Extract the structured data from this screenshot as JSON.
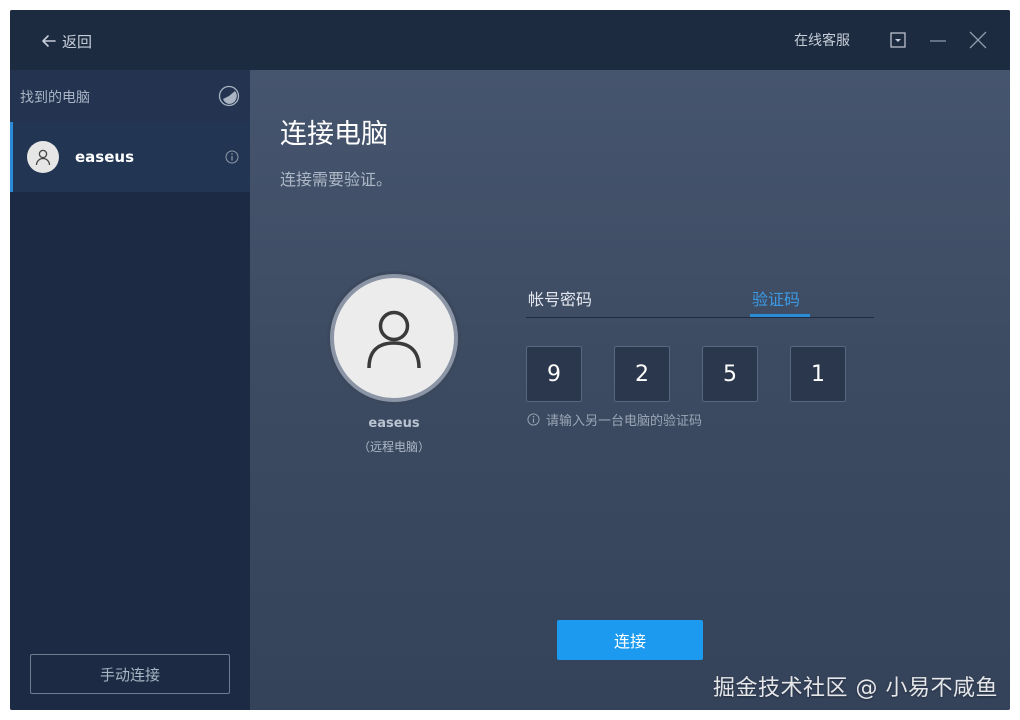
{
  "titlebar": {
    "back_label": "返回",
    "support_label": "在线客服",
    "icons": [
      "arrow-left-icon",
      "dropdown-icon",
      "minimize-icon",
      "close-icon"
    ]
  },
  "sidebar": {
    "header_label": "找到的电脑",
    "items": [
      {
        "name": "easeus",
        "icon": "user-icon"
      }
    ],
    "manual_connect_label": "手动连接"
  },
  "main": {
    "title": "连接电脑",
    "subtitle": "连接需要验证。",
    "remote": {
      "name": "easeus",
      "sub": "（远程电脑）"
    },
    "tabs": [
      {
        "label": "帐号密码",
        "active": false
      },
      {
        "label": "验证码",
        "active": true
      }
    ],
    "code_digits": [
      "9",
      "2",
      "5",
      "1"
    ],
    "hint": "请输入另一台电脑的验证码",
    "connect_label": "连接"
  },
  "watermark": "掘金技术社区 @ 小易不咸鱼",
  "colors": {
    "accent": "#1c9af0",
    "tab_active": "#3a9ae6",
    "window_bg": "#1b2a40",
    "sidebar_bg": "#1c2b43"
  }
}
